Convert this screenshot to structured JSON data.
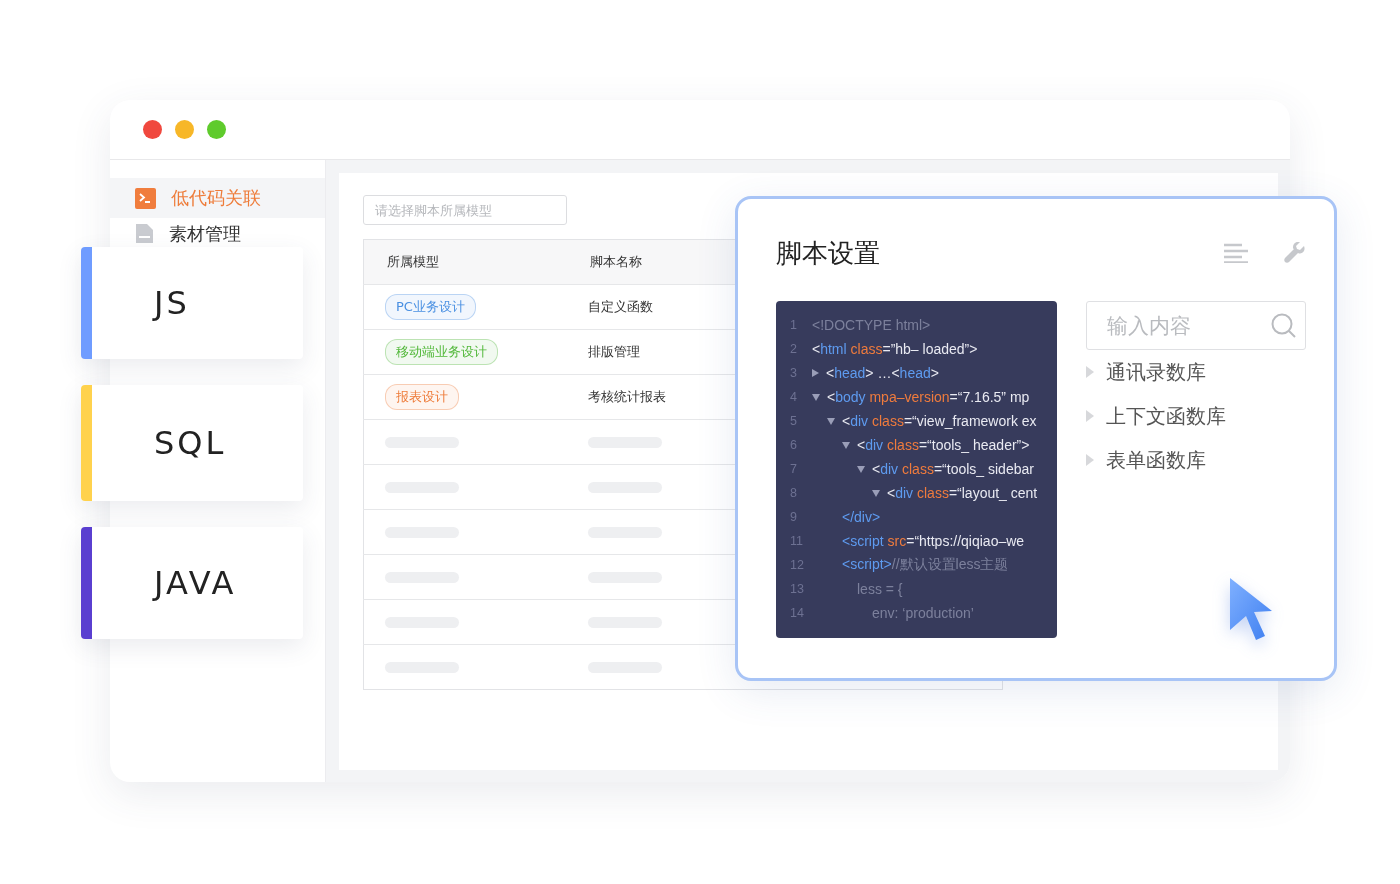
{
  "sidebar": {
    "items": [
      {
        "label": "低代码关联",
        "selected": true
      },
      {
        "label": "素材管理",
        "selected": false
      }
    ]
  },
  "model_select": {
    "placeholder": "请选择脚本所属模型"
  },
  "table": {
    "columns": [
      "所属模型",
      "脚本名称"
    ],
    "rows": [
      {
        "kind": "data",
        "tag": {
          "label": "PC业务设计",
          "color": "#4a90e2"
        },
        "name": "自定义函数"
      },
      {
        "kind": "data",
        "tag": {
          "label": "移动端业务设计",
          "color": "#52b83a"
        },
        "name": "排版管理"
      },
      {
        "kind": "data",
        "tag": {
          "label": "报表设计",
          "color": "#ee7c3a"
        },
        "name": "考核统计报表"
      },
      {
        "kind": "skeleton"
      },
      {
        "kind": "skeleton"
      },
      {
        "kind": "skeleton"
      },
      {
        "kind": "skeleton"
      },
      {
        "kind": "skeleton"
      },
      {
        "kind": "skeleton"
      }
    ]
  },
  "language_cards": [
    {
      "label": "JS",
      "color": "#6f9cff"
    },
    {
      "label": "SQL",
      "color": "#ffd24d"
    },
    {
      "label": "JAVA",
      "color": "#5a3fd0"
    }
  ],
  "script_settings": {
    "title": "脚本设置",
    "code": [
      {
        "number": "1",
        "tokens": [
          {
            "kind": "muted",
            "text": "<!DOCTYPE html>"
          }
        ]
      },
      {
        "number": "2",
        "tokens": [
          {
            "kind": "plain",
            "text": "<"
          },
          {
            "kind": "tag",
            "text": "html"
          },
          {
            "kind": "attr",
            "text": "class"
          },
          {
            "kind": "plain",
            "text": "=”hb– loaded”>"
          }
        ]
      },
      {
        "number": "3",
        "expanded": false,
        "tokens": [
          {
            "kind": "plain",
            "text": "<"
          },
          {
            "kind": "tag",
            "text": "head"
          },
          {
            "kind": "plain",
            "text": "> …<"
          },
          {
            "kind": "tag",
            "text": "head"
          },
          {
            "kind": "plain",
            "text": ">"
          }
        ]
      },
      {
        "number": "4",
        "expanded": true,
        "tokens": [
          {
            "kind": "plain",
            "text": "<"
          },
          {
            "kind": "tag",
            "text": "body"
          },
          {
            "kind": "attr",
            "text": "mpa–version"
          },
          {
            "kind": "plain",
            "text": "=“7.16.5” mp"
          }
        ],
        "children": [
          {
            "number": "5",
            "expanded": true,
            "tokens": [
              {
                "kind": "plain",
                "text": "<"
              },
              {
                "kind": "tag",
                "text": "div"
              },
              {
                "kind": "attr",
                "text": "class"
              },
              {
                "kind": "plain",
                "text": "=“view_framework ex"
              }
            ],
            "children": [
              {
                "number": "6",
                "expanded": true,
                "tokens": [
                  {
                    "kind": "plain",
                    "text": "<"
                  },
                  {
                    "kind": "tag",
                    "text": "div"
                  },
                  {
                    "kind": "attr",
                    "text": "class"
                  },
                  {
                    "kind": "plain",
                    "text": "=“tools_ header”>"
                  }
                ],
                "children": [
                  {
                    "number": "7",
                    "expanded": true,
                    "tokens": [
                      {
                        "kind": "plain",
                        "text": "<"
                      },
                      {
                        "kind": "tag",
                        "text": "div"
                      },
                      {
                        "kind": "attr",
                        "text": "class"
                      },
                      {
                        "kind": "plain",
                        "text": "=“tools_ sidebar"
                      }
                    ],
                    "children": [
                      {
                        "number": "8",
                        "expanded": true,
                        "tokens": [
                          {
                            "kind": "plain",
                            "text": "<"
                          },
                          {
                            "kind": "tag",
                            "text": "div"
                          },
                          {
                            "kind": "attr",
                            "text": "class"
                          },
                          {
                            "kind": "plain",
                            "text": "=“layout_ cent"
                          }
                        ]
                      }
                    ]
                  }
                ]
              },
              {
                "number": "9",
                "tokens": [
                  {
                    "kind": "tag",
                    "text": "</div>"
                  }
                ]
              },
              {
                "number": "11",
                "tokens": [
                  {
                    "kind": "tag",
                    "text": "<script"
                  },
                  {
                    "kind": "attr",
                    "text": "src"
                  },
                  {
                    "kind": "plain",
                    "text": "=“https://qiqiao–we"
                  }
                ]
              },
              {
                "number": "12",
                "tokens": [
                  {
                    "kind": "tag",
                    "text": "<script>"
                  },
                  {
                    "kind": "muted",
                    "text": "//默认设置less主题"
                  }
                ],
                "children": [
                  {
                    "number": "13",
                    "tokens": [
                      {
                        "kind": "muted",
                        "text": "less = {"
                      }
                    ],
                    "children": [
                      {
                        "number": "14",
                        "tokens": [
                          {
                            "kind": "muted",
                            "text": "env: ‘production’"
                          }
                        ]
                      }
                    ]
                  }
                ]
              }
            ]
          }
        ]
      }
    ],
    "search": {
      "placeholder": "输入内容"
    },
    "libraries": [
      {
        "label": "通讯录数库",
        "expanded": false
      },
      {
        "label": "上下文函数库",
        "expanded": false
      },
      {
        "label": "表单函数库",
        "expanded": false
      }
    ]
  }
}
